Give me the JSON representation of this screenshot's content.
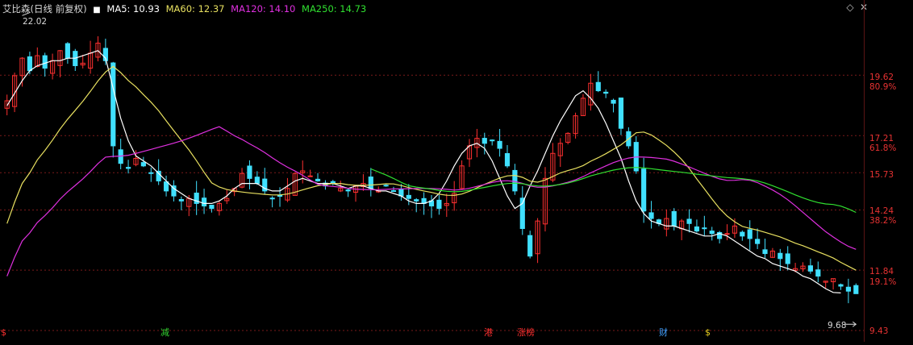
{
  "header": {
    "title": "艾比森(日线 前复权)",
    "ma5": "MA5: 10.93",
    "ma60": "MA60: 12.37",
    "ma120": "MA120: 14.10",
    "ma250": "MA250: 14.73"
  },
  "colors": {
    "up": "#ff3030",
    "down": "#40e0ff",
    "ma5": "#ffffff",
    "ma60": "#e8e060",
    "ma120": "#e030e0",
    "ma250": "#30e030",
    "grid": "#7a1a1a",
    "axis_text": "#e83232"
  },
  "annotations": {
    "high": "22.02",
    "low": "9.68"
  },
  "events": [
    {
      "id": "jian",
      "label": "减",
      "color": "green"
    },
    {
      "id": "gang",
      "label": "港",
      "color": "red"
    },
    {
      "id": "zhangtingbang",
      "label": "涨榜",
      "color": "red"
    },
    {
      "id": "cai",
      "label": "财",
      "color": "blue"
    },
    {
      "id": "dollar1",
      "label": "$",
      "color": "red"
    },
    {
      "id": "dollar2",
      "label": "$",
      "color": "red"
    }
  ],
  "chart_data": {
    "type": "candlestick",
    "title": "艾比森(日线 前复权)",
    "y_axis_ticks": [
      "19.62",
      "17.21",
      "15.73",
      "14.24",
      "11.84",
      "9.43"
    ],
    "y_axis_pct_ticks": [
      "80.9%",
      "61.8%",
      "38.2%",
      "19.1%"
    ],
    "ylim": [
      9.43,
      22.3
    ],
    "close": [
      18.6,
      19.6,
      20.3,
      19.8,
      20.4,
      19.9,
      20.2,
      20.6,
      20.3,
      20.0,
      20.1,
      20.5,
      20.9,
      20.2,
      16.8,
      16.1,
      15.9,
      16.3,
      16.0,
      15.7,
      15.4,
      15.0,
      14.8,
      14.6,
      14.7,
      14.5,
      14.4,
      14.3,
      14.5,
      14.7,
      15.1,
      15.7,
      15.5,
      15.3,
      15.0,
      14.7,
      14.8,
      15.1,
      15.7,
      15.8,
      15.6,
      15.4,
      15.2,
      15.3,
      15.1,
      15.0,
      15.2,
      15.3,
      15.1,
      15.0,
      15.2,
      15.0,
      14.8,
      14.7,
      14.6,
      14.5,
      14.4,
      14.3,
      14.5,
      14.9,
      16.0,
      16.8,
      17.1,
      16.9,
      17.0,
      16.7,
      16.0,
      15.0,
      13.5,
      12.4,
      13.8,
      15.5,
      16.5,
      16.9,
      17.3,
      18.0,
      18.7,
      19.3,
      19.0,
      18.9,
      18.5,
      17.5,
      16.8,
      15.8,
      14.2,
      13.9,
      13.7,
      13.9,
      13.6,
      13.8,
      13.7,
      13.4,
      13.5,
      13.3,
      13.1,
      13.3,
      13.6,
      13.2,
      13.1,
      12.9,
      12.5,
      12.6,
      12.3,
      12.1,
      11.9,
      12.0,
      11.8,
      11.6,
      11.4,
      11.5,
      11.2,
      11.0,
      10.9
    ],
    "ma5": [
      18.4,
      18.9,
      19.4,
      19.8,
      20.0,
      20.1,
      20.2,
      20.2,
      20.3,
      20.3,
      20.4,
      20.5,
      20.6,
      20.3,
      19.1,
      17.9,
      17.0,
      16.4,
      16.2,
      16.0,
      15.7,
      15.4,
      15.1,
      14.9,
      14.7,
      14.6,
      14.5,
      14.5,
      14.6,
      14.8,
      15.1,
      15.3,
      15.3,
      15.3,
      15.1,
      15.0,
      15.0,
      15.2,
      15.4,
      15.5,
      15.4,
      15.3,
      15.3,
      15.3,
      15.2,
      15.1,
      15.2,
      15.2,
      15.1,
      15.0,
      15.0,
      14.9,
      14.8,
      14.6,
      14.5,
      14.5,
      14.6,
      14.9,
      15.4,
      16.0,
      16.5,
      16.8,
      16.9,
      16.7,
      16.2,
      15.5,
      14.8,
      14.3,
      14.5,
      15.2,
      15.8,
      16.5,
      17.2,
      17.8,
      18.3,
      18.8,
      19.0,
      18.7,
      18.3,
      17.7,
      17.0,
      16.3,
      15.4,
      14.6,
      14.1,
      13.8,
      13.7,
      13.6,
      13.6,
      13.5,
      13.4,
      13.3,
      13.2,
      13.2,
      13.3,
      13.2,
      13.0,
      12.8,
      12.6,
      12.4,
      12.3,
      12.1,
      12.0,
      11.9,
      11.8,
      11.6,
      11.5,
      11.3,
      11.1,
      10.95,
      10.93
    ]
  }
}
